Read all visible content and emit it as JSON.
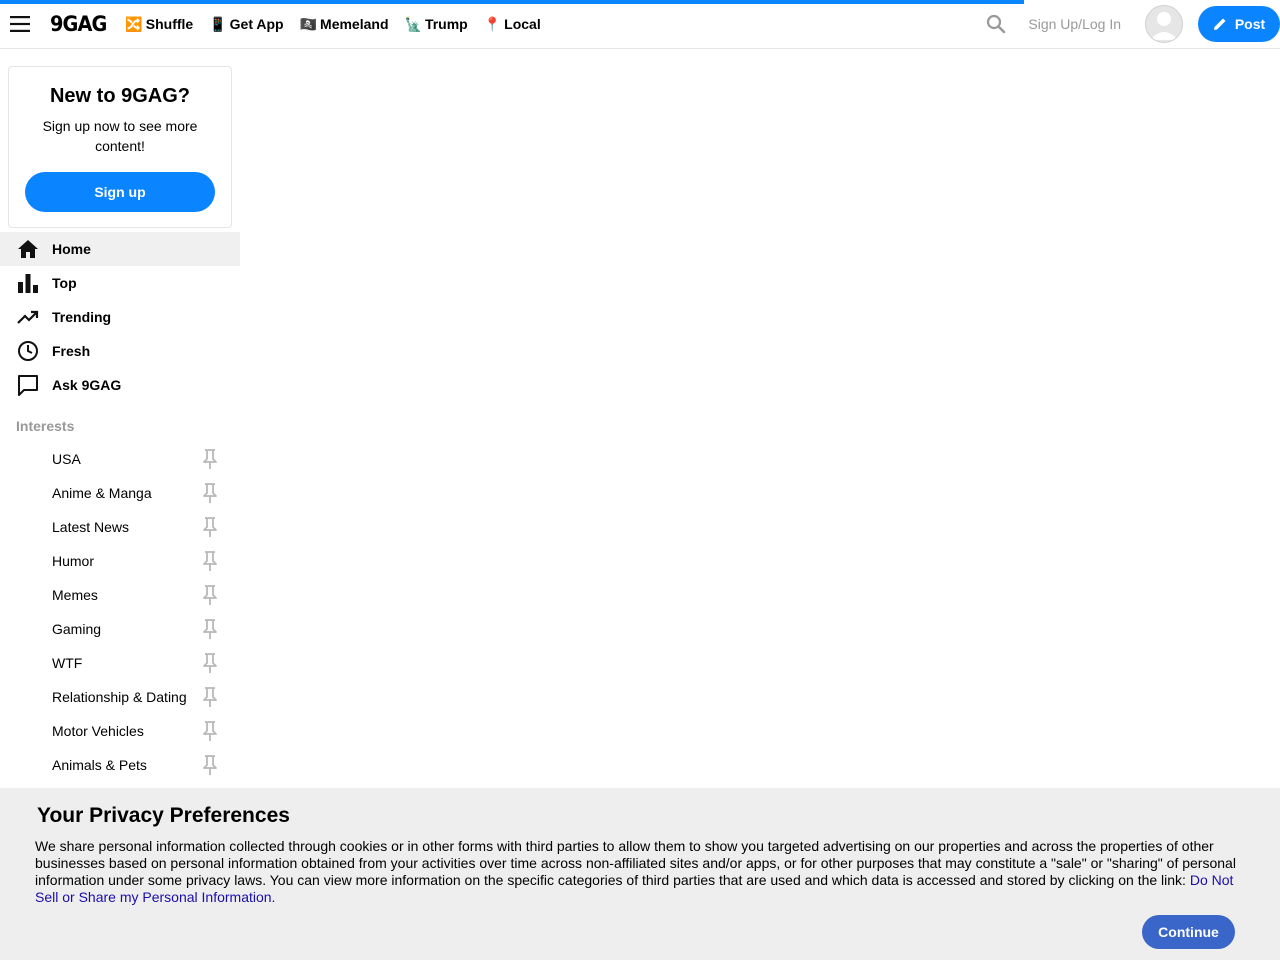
{
  "loading_progress": 0.8,
  "header": {
    "logo": "9GAG",
    "nav": [
      {
        "emoji": "🔀",
        "label": "Shuffle"
      },
      {
        "emoji": "📱",
        "label": "Get App"
      },
      {
        "emoji": "🏴‍☠️",
        "label": "Memeland"
      },
      {
        "emoji": "🗽",
        "label": "Trump"
      },
      {
        "emoji": "📍",
        "label": "Local"
      }
    ],
    "login_label": "Sign Up/Log In",
    "post_label": "Post"
  },
  "signup_card": {
    "title": "New to 9GAG?",
    "text": "Sign up now to see more content!",
    "button": "Sign up"
  },
  "menu": [
    {
      "icon": "home-icon",
      "label": "Home",
      "active": true
    },
    {
      "icon": "bar-chart-icon",
      "label": "Top"
    },
    {
      "icon": "trending-icon",
      "label": "Trending"
    },
    {
      "icon": "clock-icon",
      "label": "Fresh"
    },
    {
      "icon": "chat-icon",
      "label": "Ask 9GAG"
    }
  ],
  "interests_heading": "Interests",
  "interests": [
    "USA",
    "Anime & Manga",
    "Latest News",
    "Humor",
    "Memes",
    "Gaming",
    "WTF",
    "Relationship & Dating",
    "Motor Vehicles",
    "Animals & Pets"
  ],
  "privacy": {
    "title": "Your Privacy Preferences",
    "text": "We share personal information collected through cookies or in other forms with third parties to allow them to show you targeted advertising on our properties and across the properties of other businesses based on personal information obtained from your activities over time across non-affiliated sites and/or apps, or for other purposes that may constitute a \"sale\" or \"sharing\" of personal information under some privacy laws. You can view more information on the specific categories of third parties that are used and which data is accessed and stored by clicking on the link: ",
    "link": "Do Not Sell or Share my Personal Information.",
    "button": "Continue"
  },
  "colors": {
    "accent": "#0a84ff",
    "continue": "#3a65c9",
    "banner_bg": "#eeeeee"
  }
}
